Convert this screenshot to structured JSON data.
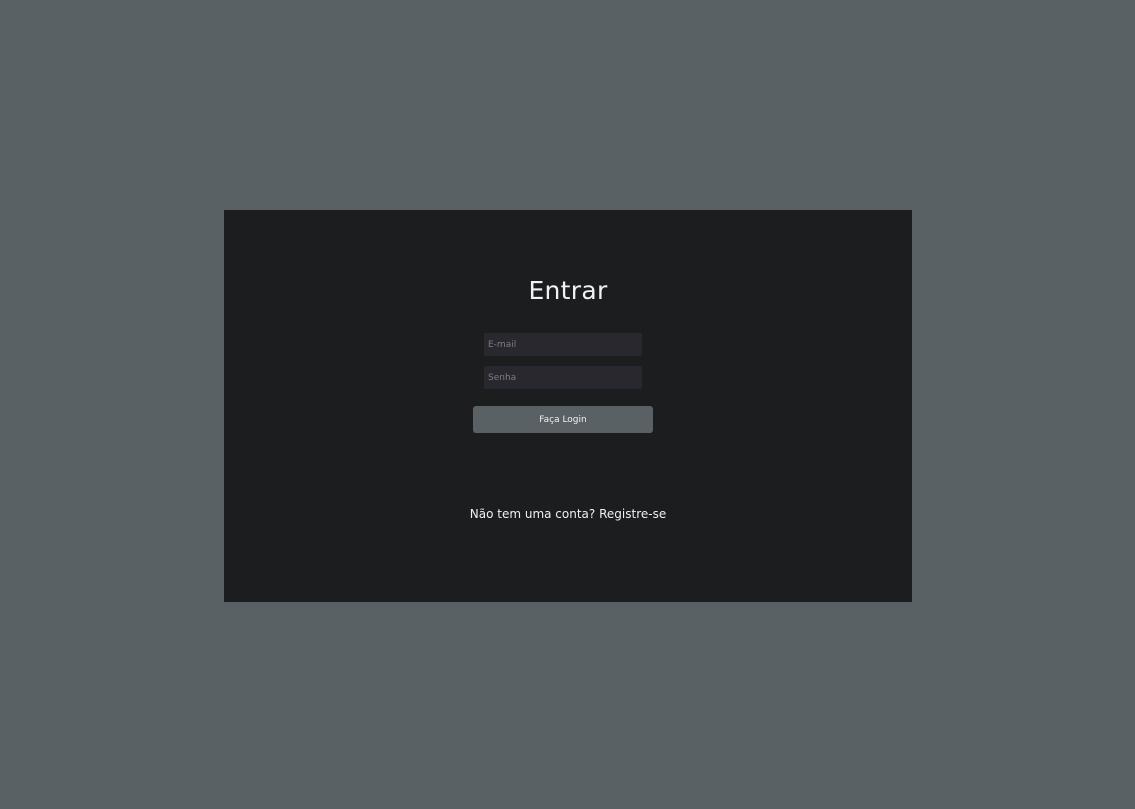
{
  "login": {
    "title": "Entrar",
    "email_placeholder": "E-mail",
    "password_placeholder": "Senha",
    "submit_label": "Faça Login",
    "register_prompt": "Não tem uma conta?",
    "register_link": "Registre-se"
  },
  "colors": {
    "page_background": "#5a6164",
    "card_background": "#1c1d1f",
    "input_background": "#2a282f",
    "button_background": "#5a6164"
  }
}
